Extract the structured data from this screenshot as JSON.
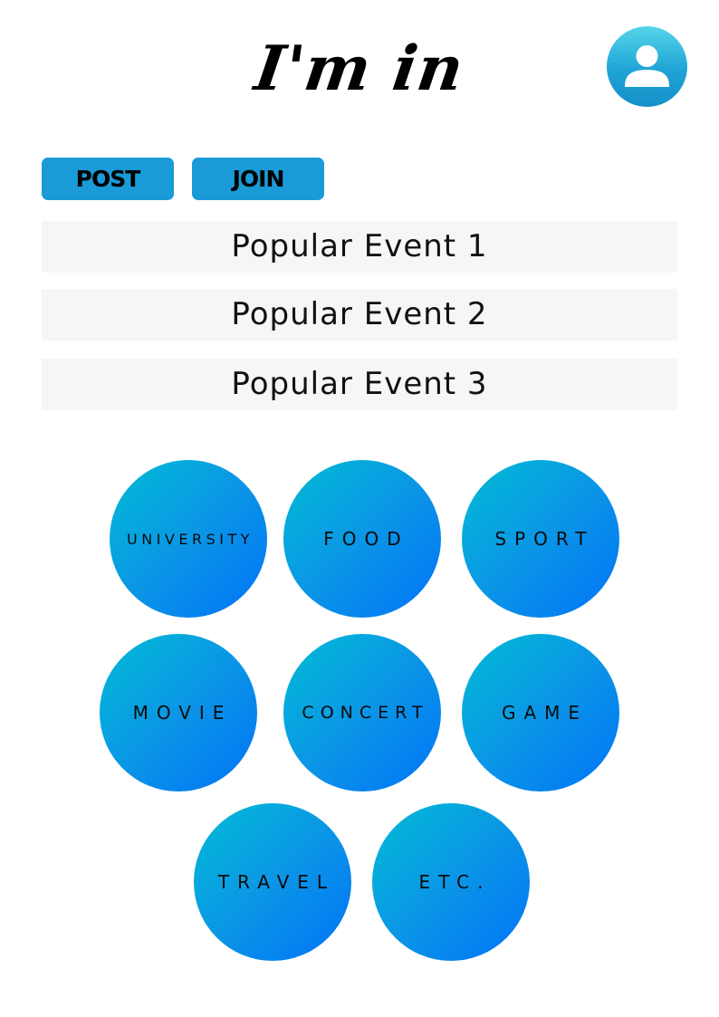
{
  "header": {
    "logo_text": "I'm in",
    "profile_icon": "user-icon"
  },
  "actions": {
    "post_label": "POST",
    "join_label": "JOIN"
  },
  "popular_events": [
    "Popular Event 1",
    "Popular Event 2",
    "Popular Event 3"
  ],
  "categories": [
    "UNIVERSITY",
    "FOOD",
    "SPORT",
    "MOVIE",
    "CONCERT",
    "GAME",
    "TRAVEL",
    "ETC."
  ],
  "colors": {
    "accent": "#1a9ad6",
    "gradient_start": "#00bcd4",
    "gradient_end": "#0073f7",
    "row_background": "#f6f6f6"
  }
}
